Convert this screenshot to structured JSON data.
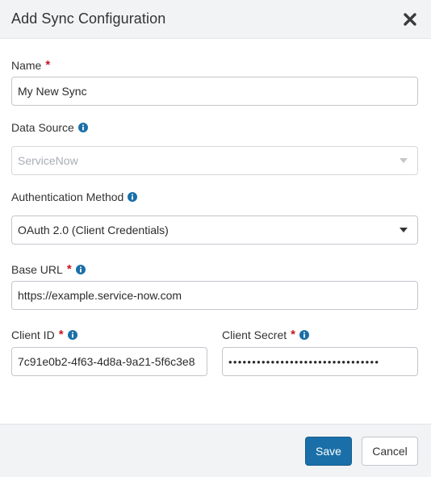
{
  "header": {
    "title": "Add Sync Configuration"
  },
  "icons": {
    "close": "close-x-icon",
    "info": "info-circle-icon",
    "dropdown": "caret-down-icon"
  },
  "form": {
    "name": {
      "label": "Name",
      "required": "*",
      "value": "My New Sync"
    },
    "data_source": {
      "label": "Data Source",
      "value": "ServiceNow",
      "disabled": true
    },
    "auth_method": {
      "label": "Authentication Method",
      "value": "OAuth 2.0 (Client Credentials)"
    },
    "base_url": {
      "label": "Base URL",
      "required": "*",
      "value": "https://example.service-now.com"
    },
    "client_id": {
      "label": "Client ID",
      "required": "*",
      "value": "7c91e0b2-4f63-4d8a-9a21-5f6c3e8"
    },
    "client_secret": {
      "label": "Client Secret",
      "required": "*",
      "value": "••••••••••••••••••••••••••••••••"
    }
  },
  "footer": {
    "save_label": "Save",
    "cancel_label": "Cancel"
  },
  "colors": {
    "primary": "#1a6fa8",
    "required": "#c9151e",
    "info": "#1a6fa8"
  }
}
